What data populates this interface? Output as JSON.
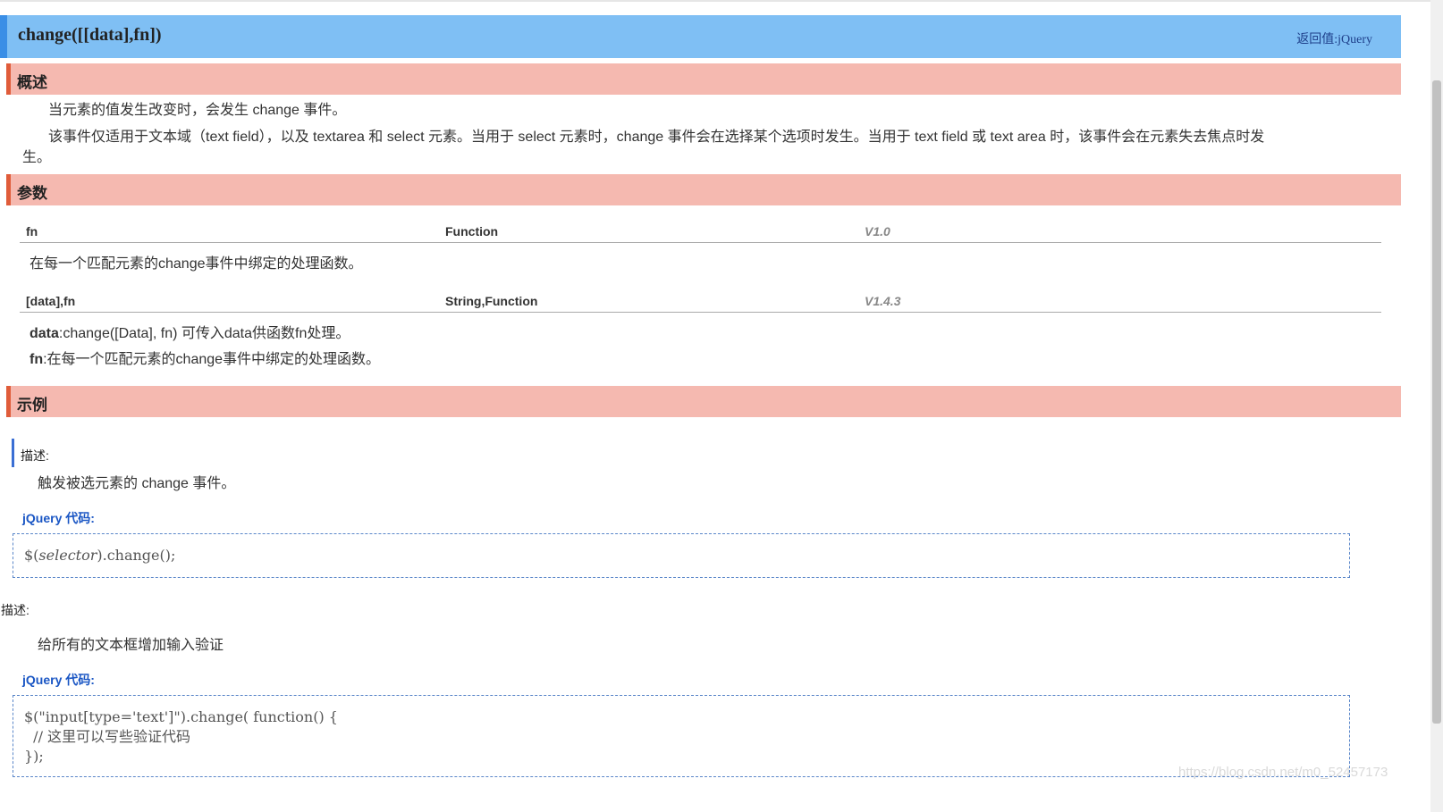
{
  "header": {
    "title": "change([[data],fn])",
    "return_value": "返回值:jQuery"
  },
  "sections": {
    "overview": "概述",
    "params": "参数",
    "examples": "示例"
  },
  "overview": {
    "line1": "当元素的值发生改变时，会发生 change 事件。",
    "line2a": "该事件仅适用于文本域（text field），以及 textarea 和 select 元素。当用于 select 元素时，change 事件会在选择某个选项时发生。当用于 text field 或 text area 时，该事件会在元素失去焦点时发",
    "line2b": "生。"
  },
  "params": [
    {
      "name": "fn",
      "type": "Function",
      "version": "V1.0",
      "desc": "在每一个匹配元素的change事件中绑定的处理函数。"
    },
    {
      "name": "[data],fn",
      "type": "String,Function",
      "version": "V1.4.3",
      "details": [
        {
          "key": "data",
          "text": ":change([Data], fn) 可传入data供函数fn处理。"
        },
        {
          "key": "fn",
          "text": ":在每一个匹配元素的change事件中绑定的处理函数。"
        }
      ]
    }
  ],
  "examples": [
    {
      "label": "描述:",
      "desc": "触发被选元素的 change 事件。",
      "code_label": "jQuery 代码:",
      "code": {
        "prefix": "$(",
        "arg": "selector",
        "suffix": ").change();"
      }
    },
    {
      "label": "描述:",
      "desc": "给所有的文本框增加输入验证",
      "code_label": "jQuery 代码:",
      "code_lines": [
        "$(\"input[type='text']\").change( function() {",
        "  // 这里可以写些验证代码",
        "});"
      ]
    }
  ],
  "watermark": "https://blog.csdn.net/m0_52457173"
}
